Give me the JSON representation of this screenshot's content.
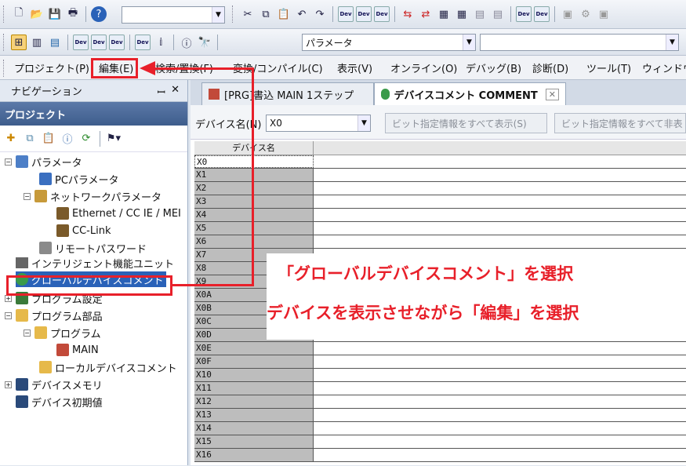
{
  "toolbar1": {
    "icons": [
      "new-file-icon",
      "open-folder-icon",
      "save-icon",
      "print-icon",
      "help-icon"
    ],
    "combo_value": "",
    "icons2": [
      "cut-icon",
      "copy-icon",
      "paste-icon",
      "undo-icon",
      "redo-icon"
    ]
  },
  "toolbar2": {
    "combo_value": "パラメータ",
    "dev_icon_label": "Dev"
  },
  "menu": {
    "items": [
      "プロジェクト(P)",
      "編集(E)",
      "検索/置換(F)",
      "変換/コンパイル(C)",
      "表示(V)",
      "オンライン(O)",
      "デバッグ(B)",
      "診断(D)",
      "ツール(T)",
      "ウィンドウ("
    ]
  },
  "navigation": {
    "title": "ナビゲーション",
    "pin": "ꟷ",
    "close": "✕",
    "project_header": "プロジェクト"
  },
  "tree": {
    "items": [
      "パラメータ",
      "PCパラメータ",
      "ネットワークパラメータ",
      "Ethernet / CC IE / MEI",
      "CC-Link",
      "リモートパスワード",
      "インテリジェント機能ユニット",
      "グローバルデバイスコメント",
      "プログラム設定",
      "プログラム部品",
      "プログラム",
      "MAIN",
      "ローカルデバイスコメント",
      "デバイスメモリ",
      "デバイス初期値"
    ]
  },
  "tabs": {
    "tab1": "[PRG]書込 MAIN 1ステップ",
    "tab2": "デバイスコメント COMMENT",
    "close": "✕"
  },
  "device_bar": {
    "label": "デバイス名(N)",
    "value": "X0",
    "btn_show_all": "ビット指定情報をすべて表示(S)",
    "btn_hide_all": "ビット指定情報をすべて非表"
  },
  "grid": {
    "header": "デバイス名",
    "rows": [
      "X0",
      "X1",
      "X2",
      "X3",
      "X4",
      "X5",
      "X6",
      "X7",
      "X8",
      "X9",
      "X0A",
      "X0B",
      "X0C",
      "X0D",
      "X0E",
      "X0F",
      "X10",
      "X11",
      "X12",
      "X13",
      "X14",
      "X15",
      "X16"
    ]
  },
  "callout": {
    "line1": "「グローバルデバイスコメント」を選択",
    "line2": "デバイスを表示させながら「編集」を選択"
  },
  "colors": {
    "accent_red": "#e8202a",
    "nav_header": "#3e5d8c",
    "selected_item": "#2a62b8"
  }
}
